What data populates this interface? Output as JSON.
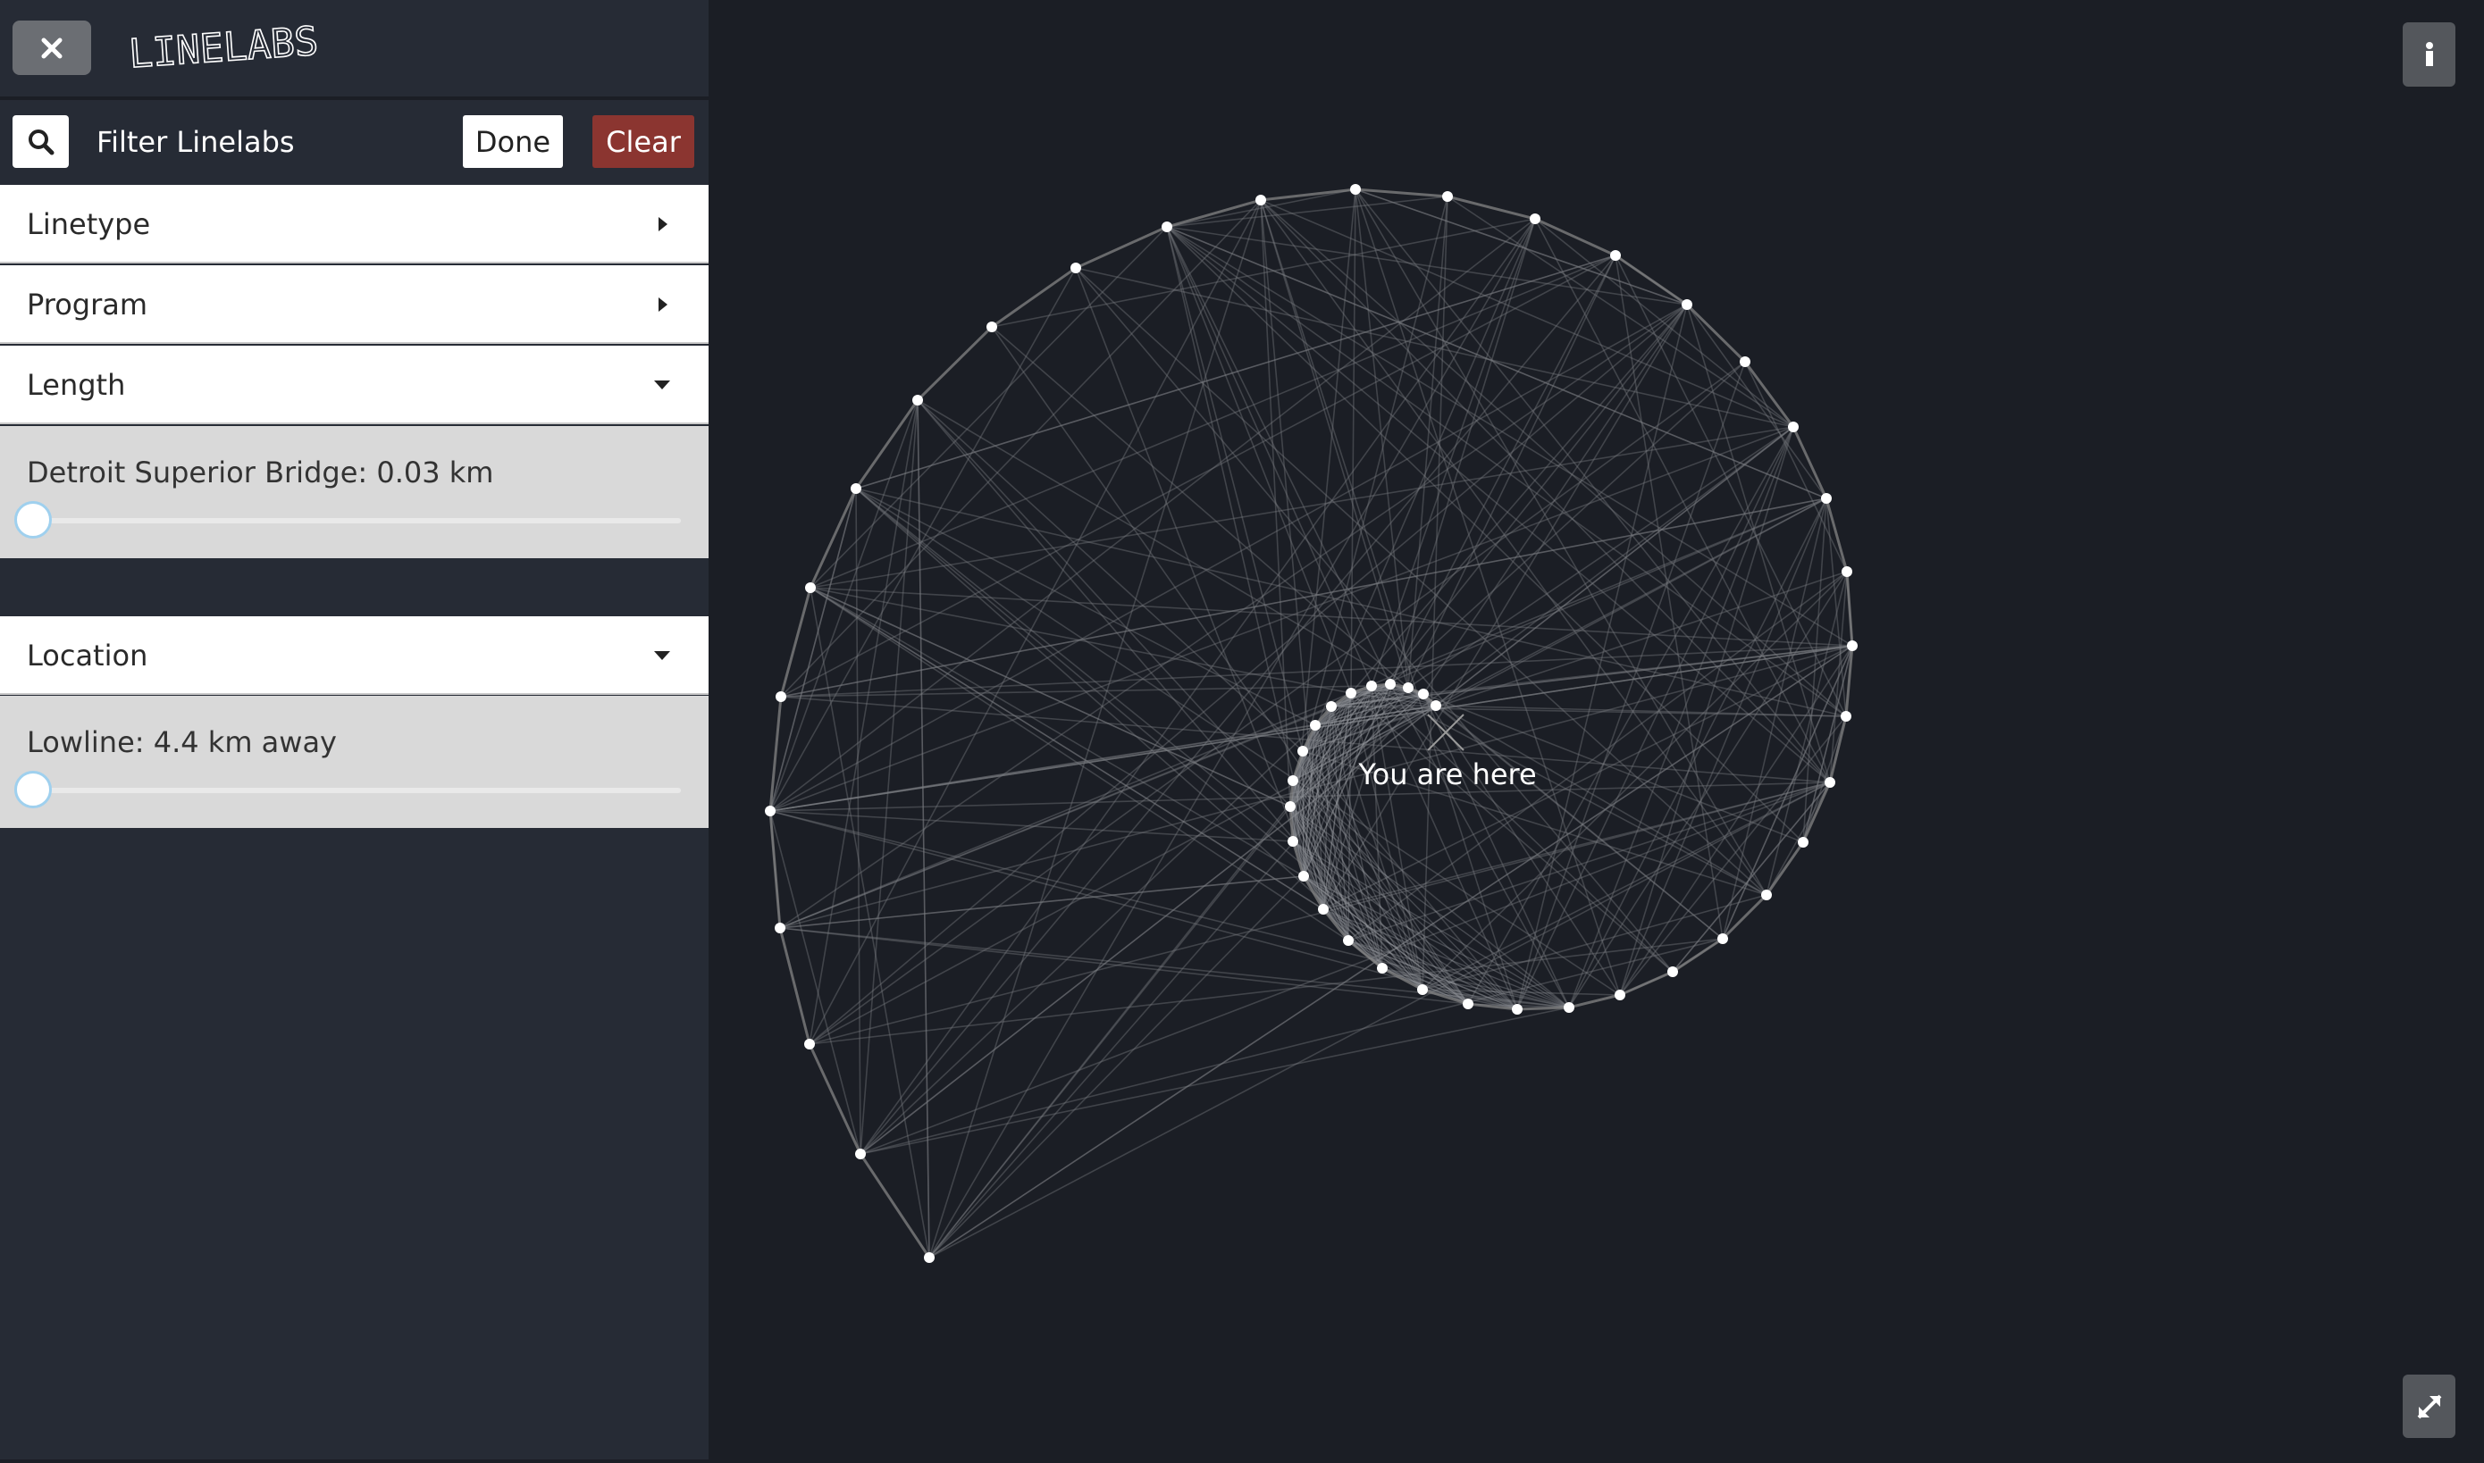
{
  "app": {
    "logo_text": "LINELABS"
  },
  "filter": {
    "label": "Filter Linelabs",
    "done_label": "Done",
    "clear_label": "Clear"
  },
  "accordion": [
    {
      "label": "Linetype",
      "state": "collapsed"
    },
    {
      "label": "Program",
      "state": "collapsed"
    },
    {
      "label": "Length",
      "state": "expanded",
      "slider_label": "Detroit Superior Bridge: 0.03 km",
      "slider_value": 0
    },
    {
      "label": "Location",
      "state": "expanded",
      "slider_label": "Lowline: 4.4 km away",
      "slider_value": 0
    }
  ],
  "map": {
    "marker_label": "You are here"
  },
  "icons": {
    "close": "close-icon",
    "search": "search-icon",
    "info": "info-icon",
    "expand": "expand-icon",
    "arrow_right": "caret-right-icon",
    "arrow_down": "caret-down-icon"
  },
  "colors": {
    "sidebar_bg": "#262b35",
    "map_bg": "#1b1e25",
    "clear_button": "#8b3530",
    "slider_thumb_border": "#9fd0ee"
  }
}
